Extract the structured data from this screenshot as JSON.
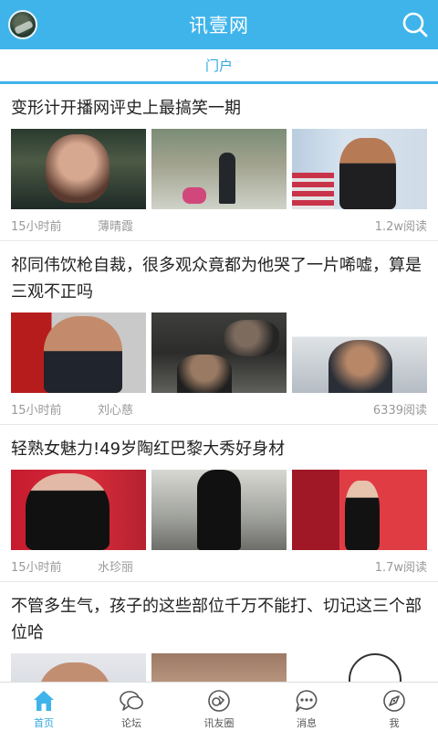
{
  "header": {
    "title": "讯壹网"
  },
  "tabs": [
    {
      "label": "门户"
    }
  ],
  "articles": [
    {
      "title": "变形计开播网评史上最搞笑一期",
      "time": "15小时前",
      "author": "薄晴霞",
      "reads": "1.2w阅读"
    },
    {
      "title": "祁同伟饮枪自裁，很多观众竟都为他哭了一片唏嘘，算是三观不正吗",
      "time": "15小时前",
      "author": "刘心慈",
      "reads": "6339阅读"
    },
    {
      "title": "轻熟女魅力!49岁陶红巴黎大秀好身材",
      "time": "15小时前",
      "author": "水珍丽",
      "reads": "1.7w阅读"
    },
    {
      "title": "不管多生气，孩子的这些部位千万不能打、切记这三个部位哈"
    }
  ],
  "bottom_nav": [
    {
      "label": "首页",
      "icon": "home-icon",
      "active": true
    },
    {
      "label": "论坛",
      "icon": "chat-bubble-icon"
    },
    {
      "label": "讯友圈",
      "icon": "moments-icon"
    },
    {
      "label": "消息",
      "icon": "message-icon"
    },
    {
      "label": "我",
      "icon": "compass-icon"
    }
  ],
  "colors": {
    "accent": "#3fb4ea",
    "tab_text": "#2ea7e3",
    "meta_text": "#999999"
  }
}
